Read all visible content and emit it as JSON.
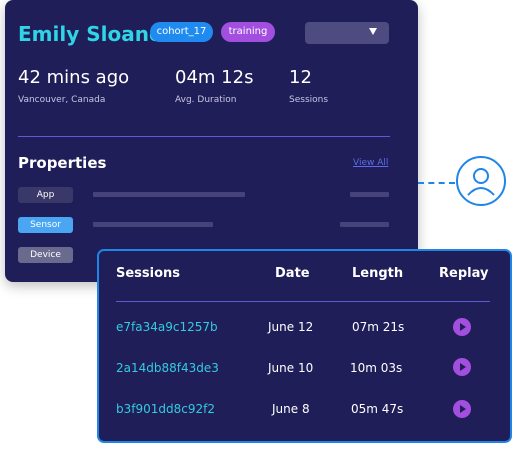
{
  "profile": {
    "name": "Emily Sloane",
    "tags": [
      "cohort_17",
      "training"
    ],
    "dropdown_icon": "caret-down-icon"
  },
  "stats": [
    {
      "value": "42 mins ago",
      "label": "Vancouver, Canada"
    },
    {
      "value": "04m 12s",
      "label": "Avg. Duration"
    },
    {
      "value": "12",
      "label": "Sessions"
    }
  ],
  "properties": {
    "title": "Properties",
    "view_all": "View All",
    "items": [
      "App",
      "Sensor",
      "Device"
    ]
  },
  "connector": {
    "icon": "user-icon",
    "color": "#1f86e8"
  },
  "sessions_table": {
    "headers": [
      "Sessions",
      "Date",
      "Length",
      "Replay"
    ],
    "rows": [
      {
        "id": "e7fa34a9c1257b",
        "date": "June 12",
        "length": "07m 21s"
      },
      {
        "id": "2a14db88f43de3",
        "date": "June 10",
        "length": "10m 03s"
      },
      {
        "id": "b3f901dd8c92f2",
        "date": "June 8",
        "length": "05m 47s"
      }
    ],
    "replay_icon": "play-icon"
  },
  "colors": {
    "card_bg": "#201e58",
    "accent_cyan": "#2fd4e6",
    "accent_blue": "#1f86e8",
    "accent_purple": "#a24fdf"
  }
}
